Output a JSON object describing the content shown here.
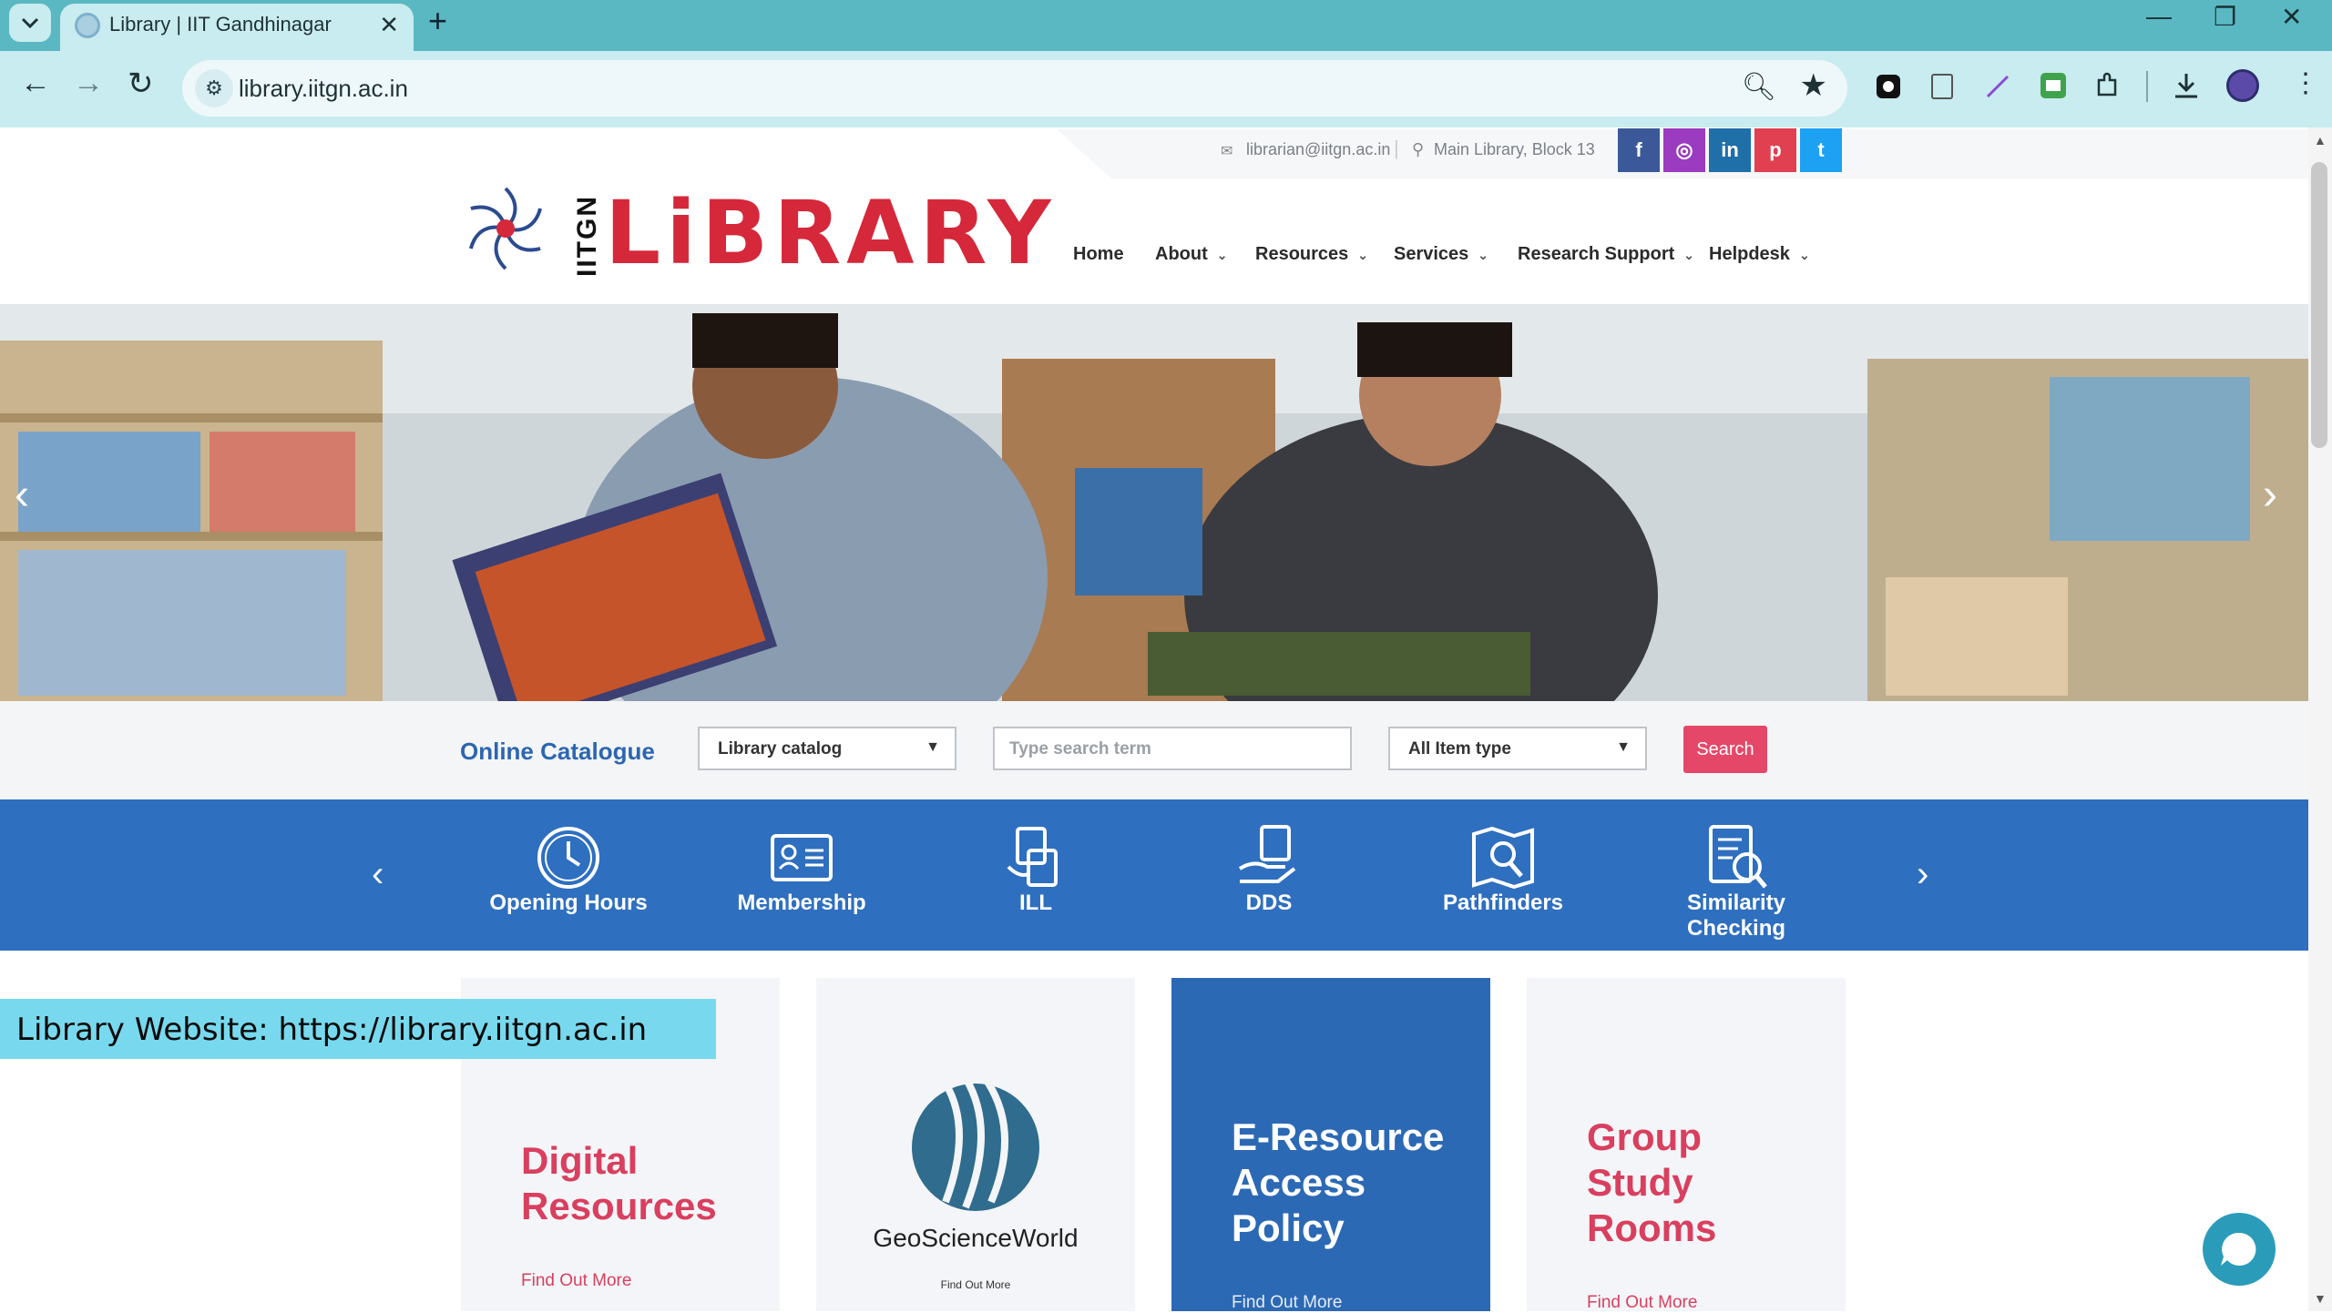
{
  "browser": {
    "tab_title": "Library | IIT Gandhinagar",
    "url": "library.iitgn.ac.in",
    "new_tab": "+",
    "tab_close": "✕",
    "back": "←",
    "forward": "→",
    "reload": "↻",
    "minimize": "—",
    "restore": "❐",
    "close": "✕"
  },
  "header": {
    "email": "librarian@iitgn.ac.in",
    "address": "Main Library, Block 13",
    "logo_prefix": "IITGN",
    "logo_text": "LiBRARY",
    "social": [
      "f",
      "◎",
      "in",
      "p",
      "t"
    ]
  },
  "nav": {
    "items": [
      {
        "label": "Home"
      },
      {
        "label": "About"
      },
      {
        "label": "Resources"
      },
      {
        "label": "Services"
      },
      {
        "label": "Research Support"
      },
      {
        "label": "Helpdesk"
      }
    ]
  },
  "search": {
    "label": "Online Catalogue",
    "catalog_select": "Library catalog",
    "placeholder": "Type search term",
    "type_select": "All Item type",
    "button": "Search"
  },
  "services": [
    {
      "label": "Opening Hours",
      "icon": "clock-icon"
    },
    {
      "label": "Membership",
      "icon": "id-card-icon"
    },
    {
      "label": "ILL",
      "icon": "book-exchange-icon"
    },
    {
      "label": "DDS",
      "icon": "document-delivery-icon"
    },
    {
      "label": "Pathfinders",
      "icon": "map-search-icon"
    },
    {
      "label": "Similarity Checking",
      "icon": "document-check-icon"
    }
  ],
  "cards": [
    {
      "title_line1": "Digital",
      "title_line2": "Resources",
      "title_line3": "",
      "link": "Find Out More"
    },
    {
      "brand": "GeoScienceWorld",
      "link": "Find Out More"
    },
    {
      "title_line1": "E-Resource",
      "title_line2": "Access",
      "title_line3": "Policy",
      "link": "Find Out More"
    },
    {
      "title_line1": "Group",
      "title_line2": "Study",
      "title_line3": "Rooms",
      "link": "Find Out More"
    }
  ],
  "caption": "Library Website: https://library.iitgn.ac.in",
  "colors": {
    "brand_red": "#d5283a",
    "brand_blue": "#2e6fbf",
    "accent_pink": "#e54768",
    "chrome_teal": "#5ab8c2"
  }
}
